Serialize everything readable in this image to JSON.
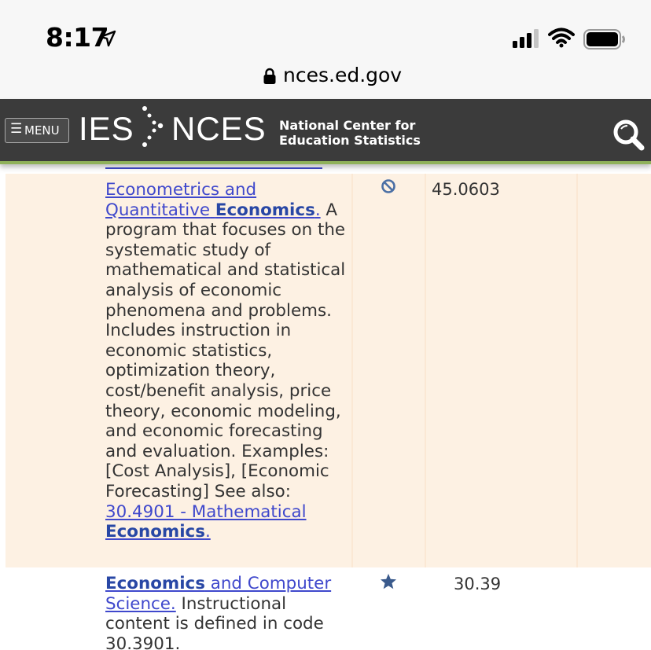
{
  "status_bar": {
    "time": "8:17"
  },
  "browser": {
    "url": "nces.ed.gov"
  },
  "header": {
    "menu_label": "MENU",
    "menu_glyph": "☰",
    "logo_left": "IES",
    "logo_right": "NCES",
    "org_line1": "National Center for",
    "org_line2": "Education Statistics",
    "icons": [
      "menu-icon",
      "search-icon"
    ]
  },
  "rows": [
    {
      "title_part1": "Econometrics and",
      "title_part2": "Quantitative",
      "title_bold": "Economics",
      "title_end": ".",
      "description": " A program that focuses on the systematic study of mathematical and statistical analysis of economic phenomena and problems. Includes instruction in economic statistics, optimization theory, cost/benefit analysis, price theory, economic modeling, and economic forecasting and evaluation. Examples: [Cost Analysis], [Economic Forecasting] See also:",
      "see_also_link": "30.4901 - Mathematical",
      "see_also_bold": "Economics",
      "see_also_end": ".",
      "status_icon": "no-entry-icon",
      "code": "45.0603"
    },
    {
      "title_bold": "Economics",
      "title_rest": " and Computer Science.",
      "description": " Instructional content is defined in code 30.3901.",
      "status_icon": "star-icon",
      "code": "30.39"
    }
  ]
}
